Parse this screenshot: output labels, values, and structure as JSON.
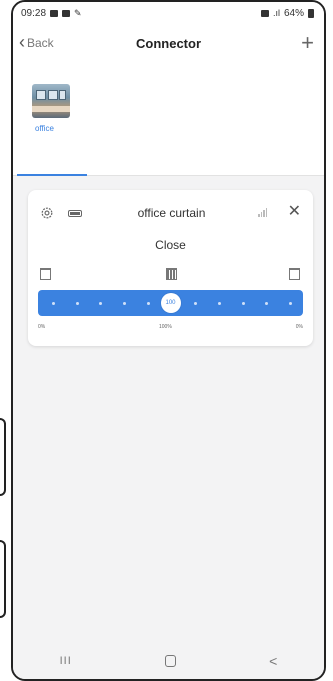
{
  "status_bar": {
    "time": "09:28",
    "battery": "64%"
  },
  "header": {
    "back_label": "Back",
    "title": "Connector",
    "add_symbol": "+"
  },
  "rooms": [
    {
      "label": "office",
      "selected": true
    }
  ],
  "device": {
    "name": "office curtain",
    "state": "Close",
    "position": 100,
    "knob_label": "100",
    "scale": {
      "left": "0%",
      "middle": "100%",
      "right": "0%"
    }
  },
  "nav": {
    "recents_symbol": "III",
    "back_symbol": "<"
  },
  "colors": {
    "accent": "#3b82e0",
    "background": "#f3f3f4"
  }
}
